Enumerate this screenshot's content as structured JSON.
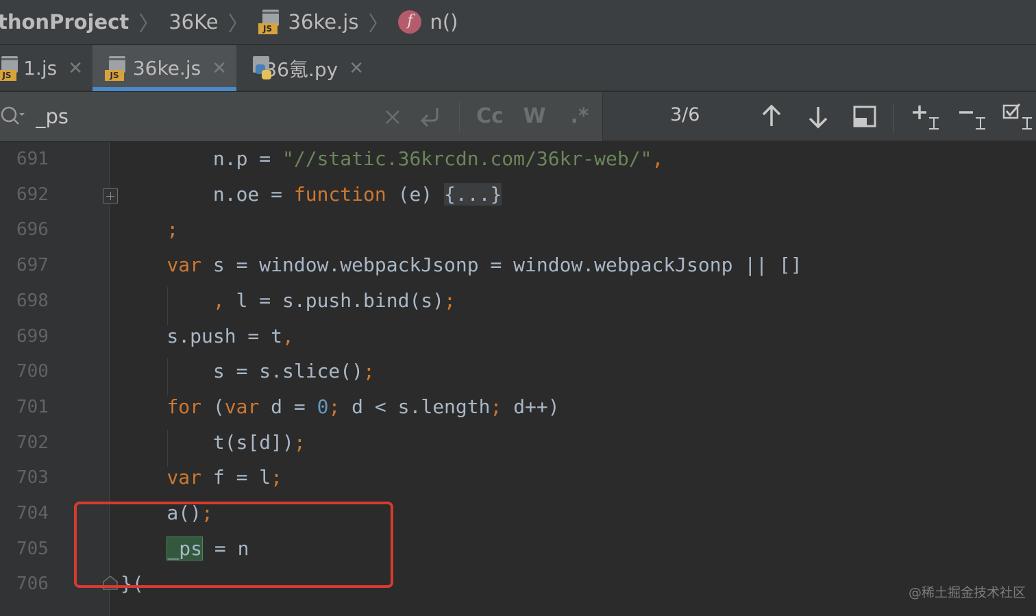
{
  "breadcrumb": {
    "items": [
      "thonProject",
      "36Ke",
      "36ke.js",
      "n()"
    ],
    "separator": "〉",
    "js_badge": "JS",
    "fn_badge": "f"
  },
  "tabs": [
    {
      "label": "1.js",
      "icon": "js-file-icon",
      "active": false
    },
    {
      "label": "36ke.js",
      "icon": "js-file-icon",
      "active": true
    },
    {
      "label": "36氪.py",
      "icon": "python-file-icon",
      "active": false
    }
  ],
  "tab_close_glyph": "✕",
  "search": {
    "query": "_ps",
    "case_label": "Cc",
    "word_label": "W",
    "regex_label": ".*",
    "match_count": "3/6"
  },
  "editor": {
    "lines": [
      {
        "num": "691",
        "tokens": [
          {
            "t": "        n.p = ",
            "c": "plain"
          },
          {
            "t": "\"//static.36krcdn.com/36kr-web/\"",
            "c": "str"
          },
          {
            "t": ",",
            "c": "kw"
          }
        ]
      },
      {
        "num": "692",
        "tokens": [
          {
            "t": "        n.oe = ",
            "c": "plain"
          },
          {
            "t": "function",
            "c": "kw"
          },
          {
            "t": " (e) ",
            "c": "plain"
          },
          {
            "t": "{...}",
            "c": "fold"
          }
        ]
      },
      {
        "num": "696",
        "tokens": [
          {
            "t": "    ;",
            "c": "kw"
          }
        ]
      },
      {
        "num": "697",
        "tokens": [
          {
            "t": "    ",
            "c": "plain"
          },
          {
            "t": "var",
            "c": "kw"
          },
          {
            "t": " s = window.webpackJsonp = window.webpackJsonp || []",
            "c": "plain"
          }
        ]
      },
      {
        "num": "698",
        "tokens": [
          {
            "t": "        ",
            "c": "plain"
          },
          {
            "t": ",",
            "c": "kw"
          },
          {
            "t": " l = s.push.bind(s)",
            "c": "plain"
          },
          {
            "t": ";",
            "c": "kw"
          }
        ]
      },
      {
        "num": "699",
        "tokens": [
          {
            "t": "    s.push = t",
            "c": "plain"
          },
          {
            "t": ",",
            "c": "kw"
          }
        ]
      },
      {
        "num": "700",
        "tokens": [
          {
            "t": "        s = s.slice()",
            "c": "plain"
          },
          {
            "t": ";",
            "c": "kw"
          }
        ]
      },
      {
        "num": "701",
        "tokens": [
          {
            "t": "    ",
            "c": "plain"
          },
          {
            "t": "for",
            "c": "kw"
          },
          {
            "t": " (",
            "c": "plain"
          },
          {
            "t": "var",
            "c": "kw"
          },
          {
            "t": " d = ",
            "c": "plain"
          },
          {
            "t": "0",
            "c": "num"
          },
          {
            "t": ";",
            "c": "kw"
          },
          {
            "t": " d < s.length",
            "c": "plain"
          },
          {
            "t": ";",
            "c": "kw"
          },
          {
            "t": " d++)",
            "c": "plain"
          }
        ]
      },
      {
        "num": "702",
        "tokens": [
          {
            "t": "        t(s[d])",
            "c": "plain"
          },
          {
            "t": ";",
            "c": "kw"
          }
        ]
      },
      {
        "num": "703",
        "tokens": [
          {
            "t": "    ",
            "c": "plain"
          },
          {
            "t": "var",
            "c": "kw"
          },
          {
            "t": " f = l",
            "c": "plain"
          },
          {
            "t": ";",
            "c": "kw"
          }
        ]
      },
      {
        "num": "704",
        "tokens": [
          {
            "t": "    a()",
            "c": "plain"
          },
          {
            "t": ";",
            "c": "kw"
          }
        ]
      },
      {
        "num": "705",
        "tokens": [
          {
            "t": "    ",
            "c": "plain"
          },
          {
            "t": "_ps",
            "c": "match"
          },
          {
            "t": " = n",
            "c": "plain"
          }
        ]
      },
      {
        "num": "706",
        "tokens": [
          {
            "t": "}(",
            "c": "plain"
          }
        ]
      }
    ]
  },
  "watermark": "@稀土掘金技术社区",
  "colors": {
    "highlight_box": "#d63b2e",
    "keyword": "#cc7832",
    "string": "#6a8759",
    "number": "#6897bb",
    "match_bg": "#32593d",
    "active_tab_underline": "#4a88c7"
  }
}
